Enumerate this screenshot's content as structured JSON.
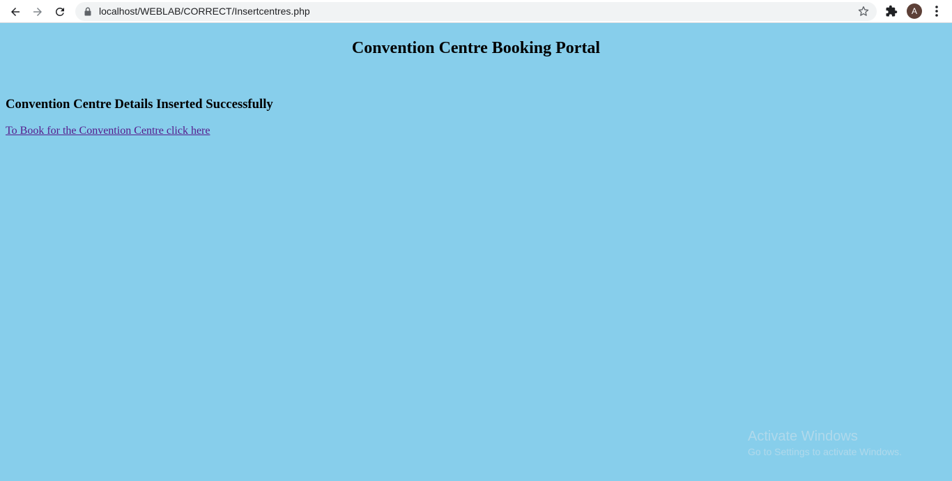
{
  "browser": {
    "url": "localhost/WEBLAB/CORRECT/Insertcentres.php",
    "profile_initial": "A",
    "icons": {
      "back": "arrow-left-icon",
      "forward": "arrow-right-icon",
      "reload": "reload-icon",
      "lock": "lock-icon",
      "bookmark": "star-icon",
      "extensions": "puzzle-icon",
      "menu": "kebab-menu-icon"
    }
  },
  "page": {
    "background_color": "#87CEEB",
    "title": "Convention Centre Booking Portal",
    "message": "Convention Centre Details Inserted Successfully",
    "link_text": "To Book for the Convention Centre click here",
    "link_color": "#551a8b"
  },
  "watermark": {
    "title": "Activate Windows",
    "subtitle": "Go to Settings to activate Windows."
  }
}
